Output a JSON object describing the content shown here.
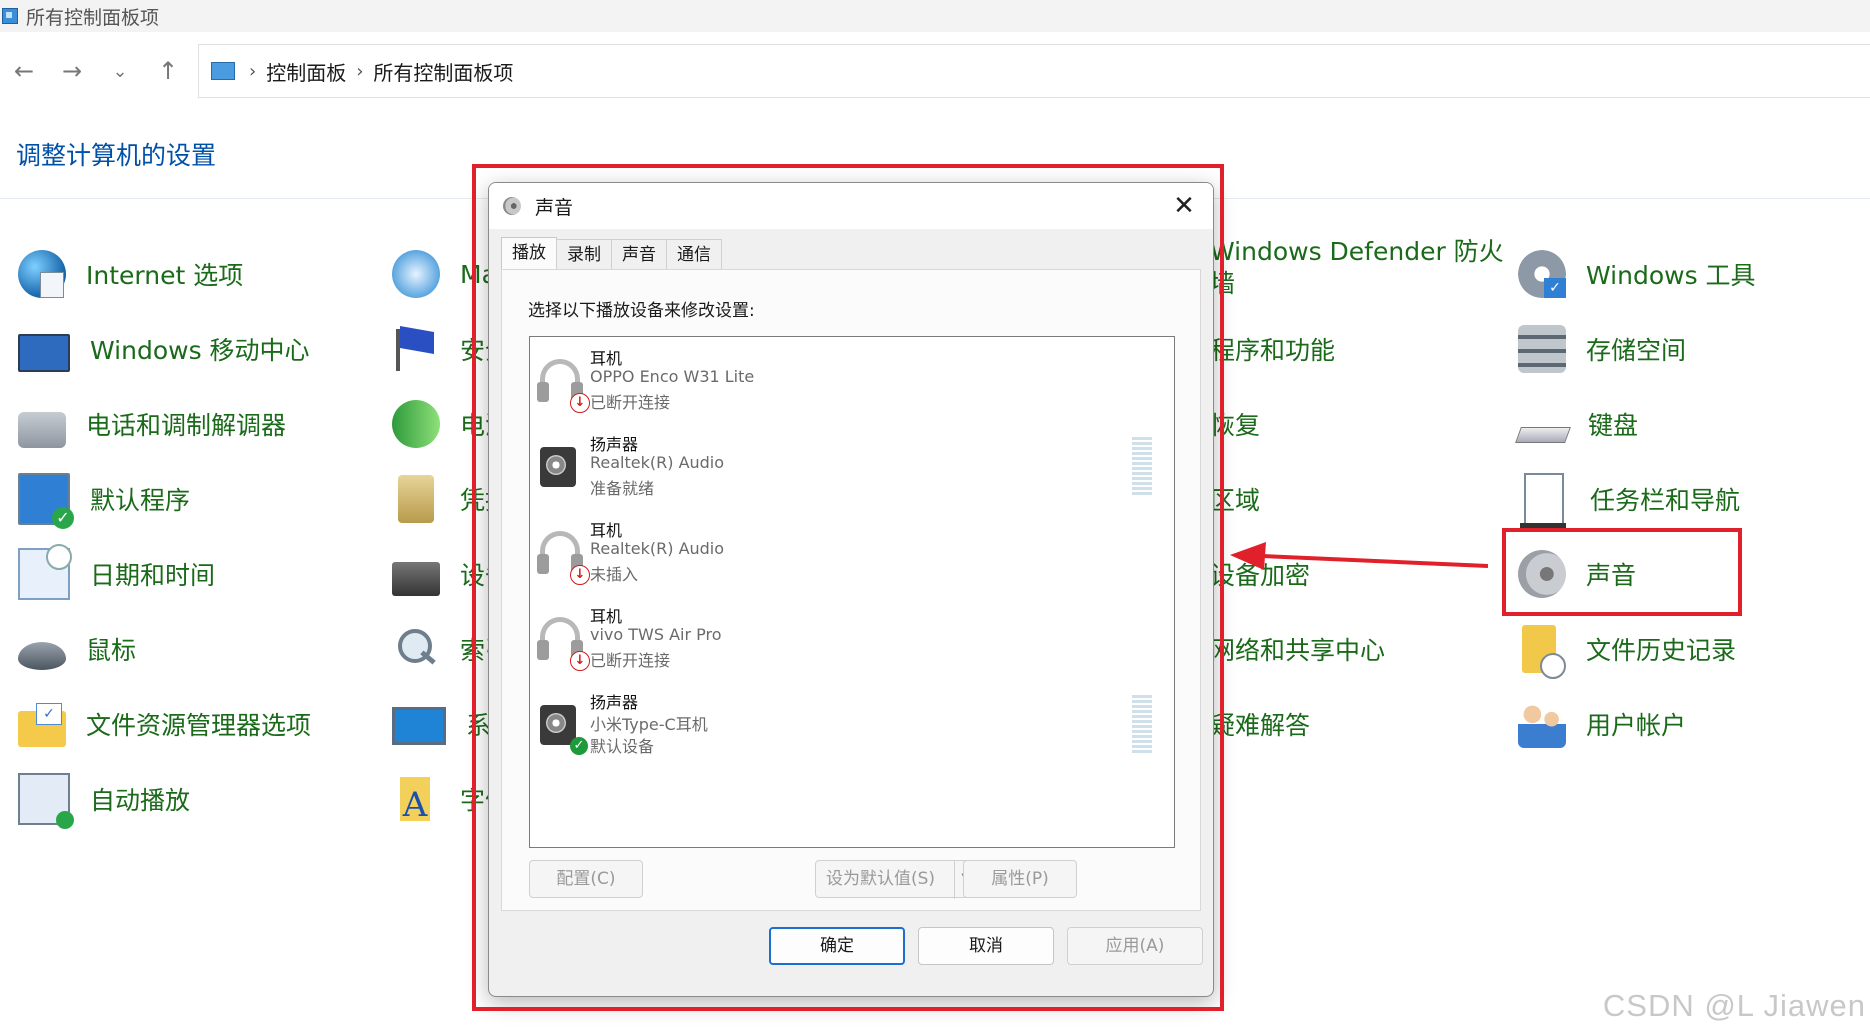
{
  "window": {
    "title": "所有控制面板项"
  },
  "nav": {
    "back": "←",
    "forward": "→",
    "recent": "⌄",
    "up": "↑",
    "breadcrumbs": [
      "控制面板",
      "所有控制面板项"
    ],
    "separator": "›"
  },
  "page_title": "调整计算机的设置",
  "items": {
    "col1": [
      "Internet 选项",
      "Windows 移动中心",
      "电话和调制解调器",
      "默认程序",
      "日期和时间",
      "鼠标",
      "文件资源管理器选项",
      "自动播放"
    ],
    "col2": [
      "Ma",
      "安全",
      "电源",
      "凭据",
      "设备",
      "索引",
      "系统",
      "字体"
    ],
    "col3": [
      "Windows Defender 防火",
      "墙",
      "程序和功能",
      "恢复",
      "区域",
      "设备加密",
      "网络和共享中心",
      "疑难解答"
    ],
    "col4": [
      "Windows 工具",
      "存储空间",
      "键盘",
      "任务栏和导航",
      "声音",
      "文件历史记录",
      "用户帐户"
    ]
  },
  "dialog": {
    "title": "声音",
    "close": "✕",
    "tabs": [
      "播放",
      "录制",
      "声音",
      "通信"
    ],
    "active_tab": "播放",
    "instruction": "选择以下播放设备来修改设置:",
    "devices": [
      {
        "name": "耳机",
        "desc": "OPPO Enco W31 Lite",
        "status": "已断开连接",
        "kind": "headphone",
        "badge": "disconnected",
        "badge_glyph": "↓",
        "meter": false
      },
      {
        "name": "扬声器",
        "desc": "Realtek(R) Audio",
        "status": "准备就绪",
        "kind": "speaker",
        "badge": "none",
        "meter": true
      },
      {
        "name": "耳机",
        "desc": "Realtek(R) Audio",
        "status": "未插入",
        "kind": "headphone",
        "badge": "disconnected",
        "badge_glyph": "↓",
        "meter": false
      },
      {
        "name": "耳机",
        "desc": "vivo TWS Air Pro",
        "status": "已断开连接",
        "kind": "headphone",
        "badge": "disconnected",
        "badge_glyph": "↓",
        "meter": false
      },
      {
        "name": "扬声器",
        "desc": "小米Type-C耳机",
        "status": "默认设备",
        "kind": "speaker",
        "badge": "default",
        "badge_glyph": "✓",
        "meter": true
      }
    ],
    "buttons": {
      "configure": "配置(C)",
      "set_default": "设为默认值(S)",
      "set_default_arrow": "▼",
      "properties": "属性(P)",
      "ok": "确定",
      "cancel": "取消",
      "apply": "应用(A)"
    }
  },
  "annotation_color": "#e0202a",
  "watermark": "CSDN @L Jiawen"
}
